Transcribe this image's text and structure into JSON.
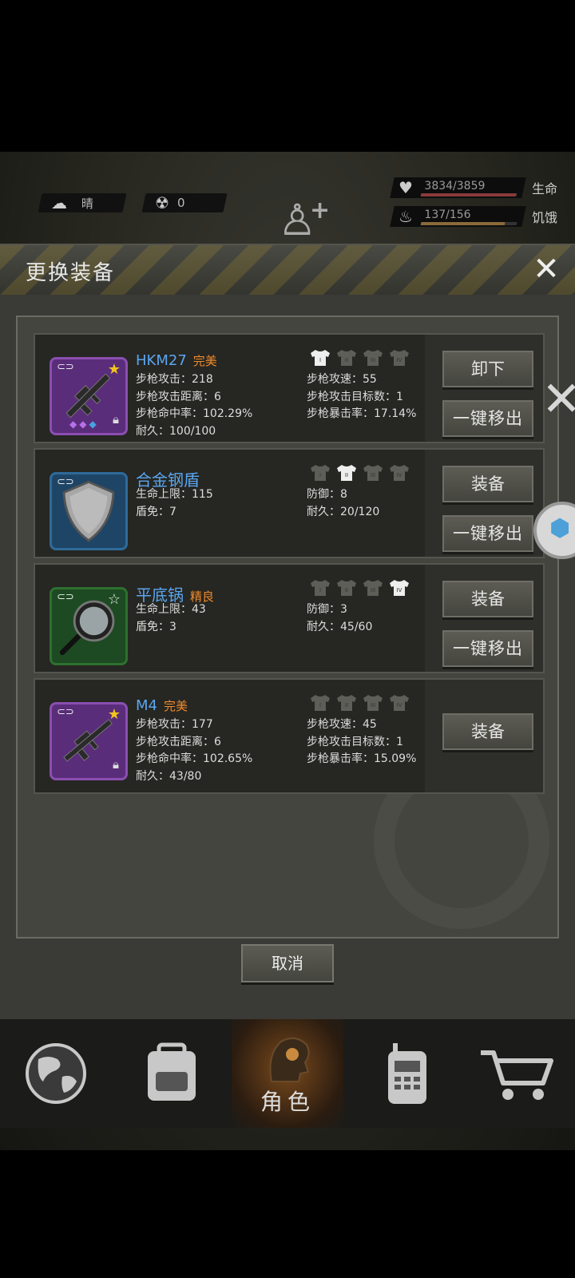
{
  "hud": {
    "weather_icon": "cloud-sun-icon",
    "weather_label": "晴",
    "radiation_icon": "radiation-icon",
    "radiation_value": "0",
    "health_icon": "heart-icon",
    "health_value": "3834/3859",
    "health_label": "生命",
    "health_ratio": 0.994,
    "hunger_icon": "stomach-icon",
    "hunger_value": "137/156",
    "hunger_label": "饥饿",
    "hunger_ratio": 0.878,
    "health_color": "#8a3a3a",
    "hunger_color": "#8a6a3a"
  },
  "modal": {
    "title": "更换装备",
    "close_label": "✕",
    "cancel_label": "取消"
  },
  "items": [
    {
      "name": "HKM27",
      "quality": "完美",
      "stats_left": [
        "步枪攻击：218",
        "步枪攻击距离：6",
        "步枪命中率：102.29%",
        "耐久：100/100"
      ],
      "stats_right": [
        "步枪攻速：55",
        "步枪攻击目标数：1",
        "步枪暴击率：17.14%"
      ],
      "primary_btn": "卸下",
      "secondary_btn": "一键移出",
      "active_shirt": 1
    },
    {
      "name": "合金钢盾",
      "quality": "",
      "stats_left": [
        "生命上限：115",
        "盾免：7"
      ],
      "stats_right": [
        "防御：8",
        "耐久：20/120"
      ],
      "primary_btn": "装备",
      "secondary_btn": "一键移出",
      "active_shirt": 2
    },
    {
      "name": "平底锅",
      "quality": "精良",
      "stats_left": [
        "生命上限：43",
        "盾免：3"
      ],
      "stats_right": [
        "防御：3",
        "耐久：45/60"
      ],
      "primary_btn": "装备",
      "secondary_btn": "一键移出",
      "active_shirt": 4
    },
    {
      "name": "M4",
      "quality": "完美",
      "stats_left": [
        "步枪攻击：177",
        "步枪攻击距离：6",
        "步枪命中率：102.65%",
        "耐久：43/80"
      ],
      "stats_right": [
        "步枪攻速：45",
        "步枪攻击目标数：1",
        "步枪暴击率：15.09%"
      ],
      "primary_btn": "装备",
      "active_shirt": 0
    }
  ],
  "nav": {
    "items": [
      "globe-icon",
      "backpack-icon",
      "character-icon",
      "radio-icon",
      "cart-icon"
    ],
    "active_label": "角色"
  }
}
